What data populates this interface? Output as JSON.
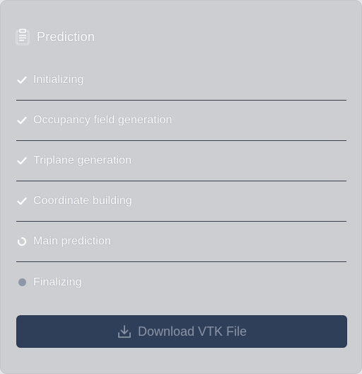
{
  "header": {
    "title": "Prediction",
    "icon": "clipboard-icon"
  },
  "steps": [
    {
      "label": "Initializing",
      "status": "done",
      "icon": "check-icon"
    },
    {
      "label": "Occupancy field generation",
      "status": "done",
      "icon": "check-icon"
    },
    {
      "label": "Triplane generation",
      "status": "done",
      "icon": "check-icon"
    },
    {
      "label": "Coordinate building",
      "status": "done",
      "icon": "check-icon"
    },
    {
      "label": "Main prediction",
      "status": "in-progress",
      "icon": "spinner-icon"
    },
    {
      "label": "Finalizing",
      "status": "pending",
      "icon": "pending-dot-icon"
    }
  ],
  "download": {
    "label": "Download VTK File",
    "icon": "download-icon"
  },
  "colors": {
    "panel_bg": "#cdced2",
    "divider": "#3a3f4c",
    "button_bg": "#2f3f5a",
    "button_text": "#8a93a6",
    "pending_dot": "#8e96a8"
  }
}
